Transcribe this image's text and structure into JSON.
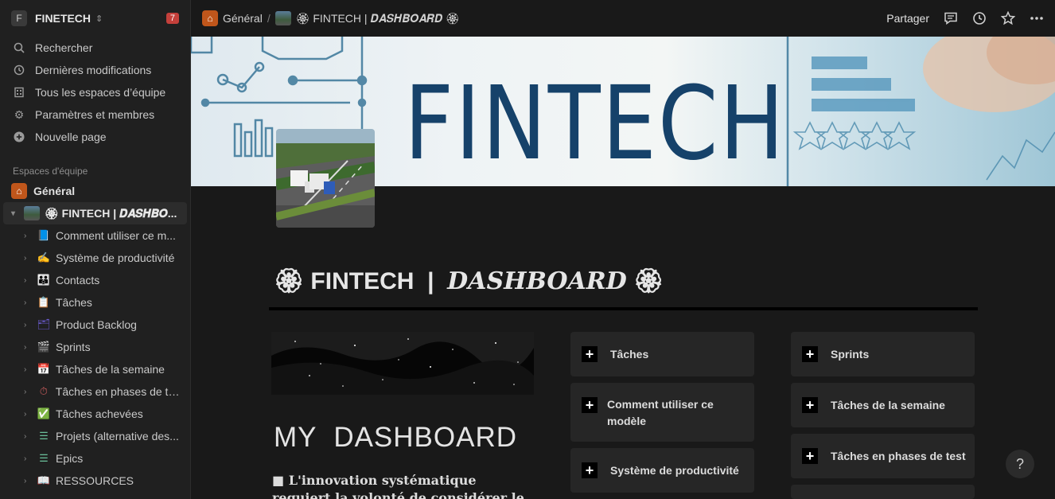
{
  "workspace": {
    "initial": "F",
    "name": "FINETECH",
    "badge": "7"
  },
  "sidebar": {
    "nav": [
      {
        "icon": "search-icon",
        "label": "Rechercher"
      },
      {
        "icon": "clock-icon",
        "label": "Dernières modifications"
      },
      {
        "icon": "building-icon",
        "label": "Tous les espaces d’équipe"
      },
      {
        "icon": "gear-icon",
        "label": "Paramètres et membres"
      },
      {
        "icon": "plus-circle-icon",
        "label": "Nouvelle page"
      }
    ],
    "section_label": "Espaces d'équipe",
    "general": "Général",
    "active_page": "🏵 FINTECH | 𝑫𝑨𝑺𝑯𝑩𝑶...",
    "pages": [
      {
        "emoji": "📘",
        "label": "Comment utiliser ce m..."
      },
      {
        "emoji": "✍",
        "label": "Système de productivité"
      },
      {
        "emoji": "👪",
        "label": "Contacts"
      },
      {
        "emoji": "📋",
        "label": "Tâches"
      },
      {
        "emoji": "🗂",
        "label": "Product Backlog"
      },
      {
        "emoji": "🎬",
        "label": "Sprints"
      },
      {
        "emoji": "📅",
        "label": "Tâches de la semaine"
      },
      {
        "emoji": "⏱",
        "label": "Tâches en phases de test"
      },
      {
        "emoji": "✅",
        "label": "Tâches achevées"
      },
      {
        "emoji": "☰",
        "label": "Projets (alternative des..."
      },
      {
        "emoji": "☰",
        "label": "Epics"
      },
      {
        "emoji": "📖",
        "label": "RESSOURCES"
      }
    ]
  },
  "topbar": {
    "crumb_general": "Général",
    "crumb_page": "🏵 FINTECH | 𝑫𝑨𝑺𝑯𝑩𝑶𝑨𝑹𝑫 🏵",
    "share": "Partager"
  },
  "cover": {
    "title": "FINTECH"
  },
  "page": {
    "title_plain": "🏵 FINTECH  |  ",
    "title_script": "DASHBOARD",
    "title_end": " 🏵",
    "heading": "MY  DASHBOARD",
    "quote": "■ L'innovation systématique requiert la volonté de considérer le"
  },
  "cards": {
    "col1": [
      "Tâches",
      "Comment utiliser ce modèle",
      "Système de productivité"
    ],
    "col2": [
      "Sprints",
      "Tâches de la semaine",
      "Tâches en phases de test"
    ]
  },
  "help": "?"
}
